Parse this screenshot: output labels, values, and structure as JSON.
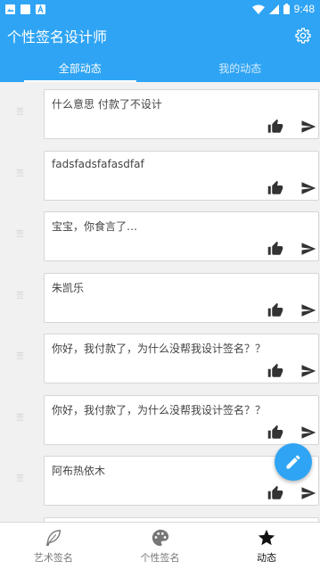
{
  "status_bar": {
    "time": "9:48",
    "icons": [
      "image-icon",
      "sim-icon",
      "a-icon",
      "wifi-icon",
      "signal-icon",
      "battery-icon"
    ]
  },
  "app_bar": {
    "title": "个性签名设计师",
    "settings_icon": "gear-icon"
  },
  "tabs": [
    {
      "label": "全部动态",
      "active": true
    },
    {
      "label": "我的动态",
      "active": false
    }
  ],
  "posts": [
    {
      "avatar_text": "签",
      "text": "什么意思  付款了不设计"
    },
    {
      "avatar_text": "签",
      "text": "fadsfadsfafasdfaf"
    },
    {
      "avatar_text": "签",
      "text": "宝宝，你食言了…"
    },
    {
      "avatar_text": "签",
      "text": "朱凯乐"
    },
    {
      "avatar_text": "签",
      "text": "你好，我付款了，为什么没帮我设计签名？？"
    },
    {
      "avatar_text": "签",
      "text": "你好，我付款了，为什么没帮我设计签名？？"
    },
    {
      "avatar_text": "签",
      "text": "阿布热依木"
    },
    {
      "avatar_text": "签",
      "text": ""
    }
  ],
  "fab": {
    "icon": "pencil-icon"
  },
  "bottom_nav": [
    {
      "label": "艺术签名",
      "icon": "feather-icon",
      "active": false
    },
    {
      "label": "个性签名",
      "icon": "palette-icon",
      "active": false
    },
    {
      "label": "动态",
      "icon": "star-icon",
      "active": true
    }
  ],
  "colors": {
    "primary": "#2fa4f4",
    "background": "#f1f1f1",
    "icon_dark": "#333333"
  }
}
